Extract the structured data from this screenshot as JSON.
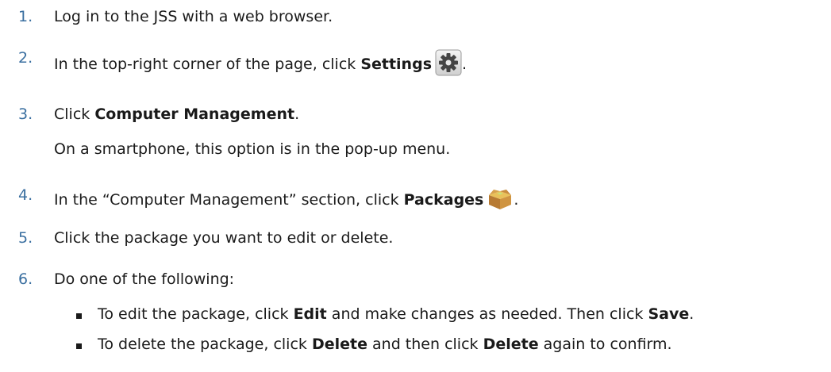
{
  "steps": [
    {
      "num": "1.",
      "text": "Log in to the JSS with a web browser."
    },
    {
      "num": "2.",
      "pre": "In the top-right corner of the page, click ",
      "bold": "Settings",
      "post": "."
    },
    {
      "num": "3.",
      "pre": "Click ",
      "bold": "Computer Management",
      "post": ".",
      "note": "On a smartphone, this option is in the pop-up menu."
    },
    {
      "num": "4.",
      "pre": "In the “Computer Management” section, click ",
      "bold": "Packages",
      "post": "."
    },
    {
      "num": "5.",
      "text": "Click the package you want to edit or delete."
    },
    {
      "num": "6.",
      "text": "Do one of the following:"
    }
  ],
  "bullets": [
    {
      "a": "To edit the package, click ",
      "b1": "Edit",
      "c": " and make changes as needed. Then click ",
      "b2": "Save",
      "d": "."
    },
    {
      "a": "To delete the package, click ",
      "b1": "Delete",
      "c": " and then click ",
      "b2": "Delete",
      "d": " again to confirm."
    }
  ],
  "icons": {
    "settings": "gear-icon",
    "packages": "package-box-icon"
  }
}
